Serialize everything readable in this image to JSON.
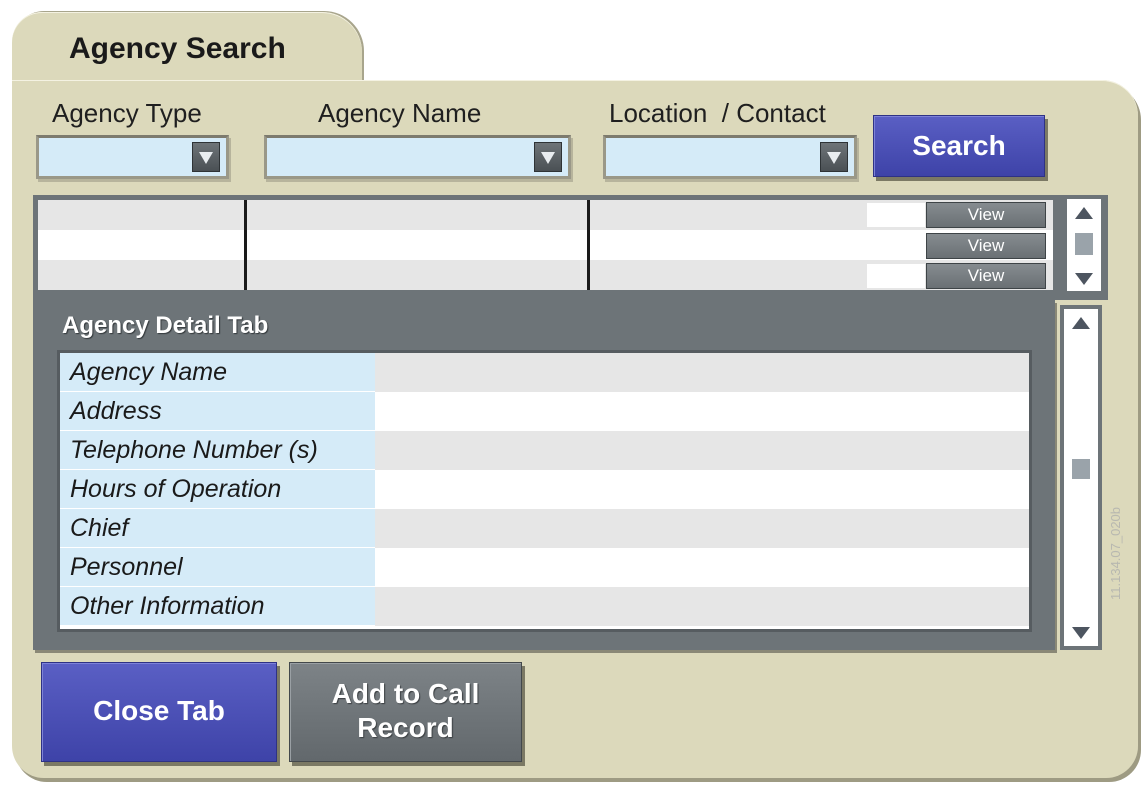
{
  "window": {
    "tab_title": "Agency Search"
  },
  "search": {
    "agency_type_label": "Agency Type",
    "agency_name_label": "Agency Name",
    "location_contact_label": "Location  / Contact",
    "agency_type_value": "",
    "agency_name_value": "",
    "location_contact_value": "",
    "search_button": "Search"
  },
  "results": {
    "rows": [
      {
        "view": "View"
      },
      {
        "view": "View"
      },
      {
        "view": "View"
      }
    ]
  },
  "detail": {
    "title": "Agency Detail Tab",
    "fields": [
      {
        "label": "Agency Name",
        "value": ""
      },
      {
        "label": "Address",
        "value": ""
      },
      {
        "label": "Telephone Number (s)",
        "value": ""
      },
      {
        "label": "Hours of Operation",
        "value": ""
      },
      {
        "label": "Chief",
        "value": ""
      },
      {
        "label": "Personnel",
        "value": ""
      },
      {
        "label": "Other Information",
        "value": ""
      }
    ]
  },
  "actions": {
    "close_tab": "Close Tab",
    "add_to_call_record": "Add to Call Record"
  },
  "watermark": "11.134.07_020b",
  "colors": {
    "panel": "#dcd9bb",
    "field_blue": "#d5ebf8",
    "button_blue": "#4a4fb6",
    "frame_grey": "#6d7478"
  },
  "icons": {
    "dropdown": "chevron-down-icon",
    "scroll_up": "scroll-up-arrow-icon",
    "scroll_down": "scroll-down-arrow-icon"
  }
}
